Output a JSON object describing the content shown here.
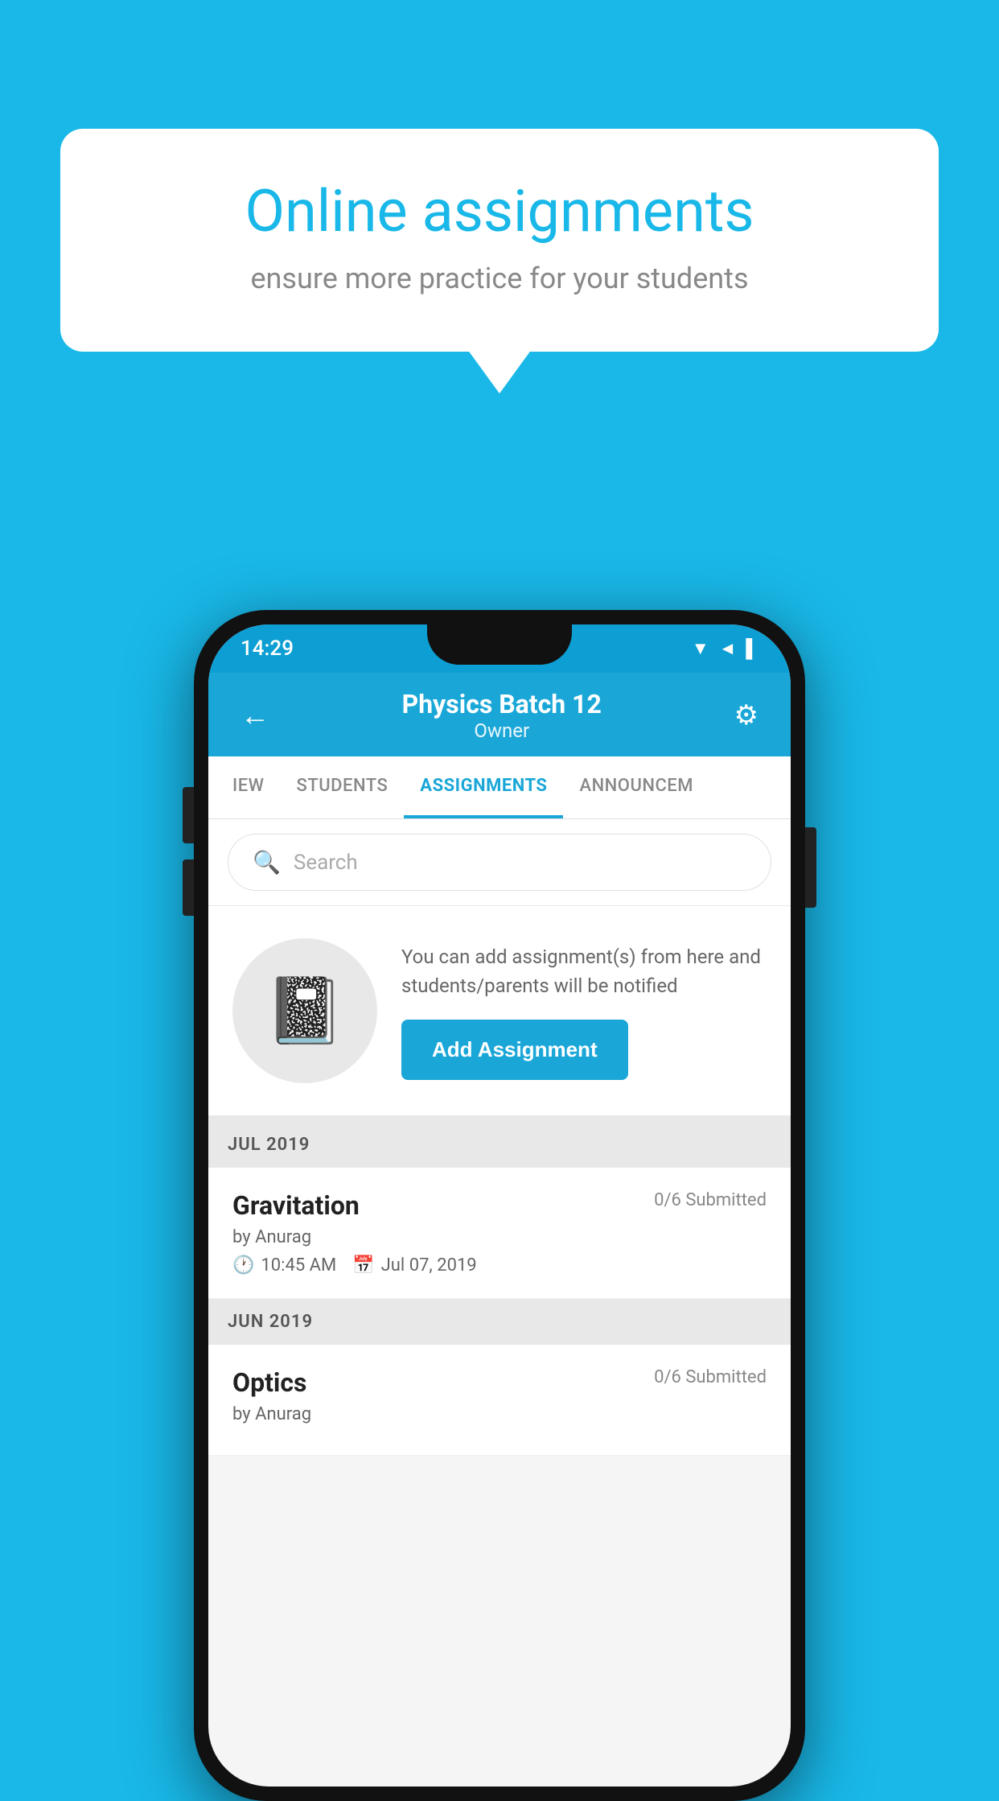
{
  "background": {
    "color": "#19B8E8"
  },
  "bubble": {
    "title": "Online assignments",
    "subtitle": "ensure more practice for your students"
  },
  "phone": {
    "statusBar": {
      "time": "14:29",
      "icons": [
        "▼",
        "◄",
        "▌"
      ]
    },
    "header": {
      "title": "Physics Batch 12",
      "subtitle": "Owner",
      "backLabel": "←",
      "settingsLabel": "⚙"
    },
    "tabs": [
      {
        "label": "IEW",
        "active": false
      },
      {
        "label": "STUDENTS",
        "active": false
      },
      {
        "label": "ASSIGNMENTS",
        "active": true
      },
      {
        "label": "ANNOUNCEM",
        "active": false
      }
    ],
    "search": {
      "placeholder": "Search"
    },
    "addAssignment": {
      "description": "You can add assignment(s) from here and students/parents will be notified",
      "buttonLabel": "Add Assignment"
    },
    "sections": [
      {
        "monthLabel": "JUL 2019",
        "items": [
          {
            "name": "Gravitation",
            "submitted": "0/6 Submitted",
            "by": "by Anurag",
            "time": "10:45 AM",
            "date": "Jul 07, 2019"
          }
        ]
      },
      {
        "monthLabel": "JUN 2019",
        "items": [
          {
            "name": "Optics",
            "submitted": "0/6 Submitted",
            "by": "by Anurag",
            "time": "",
            "date": ""
          }
        ]
      }
    ]
  }
}
